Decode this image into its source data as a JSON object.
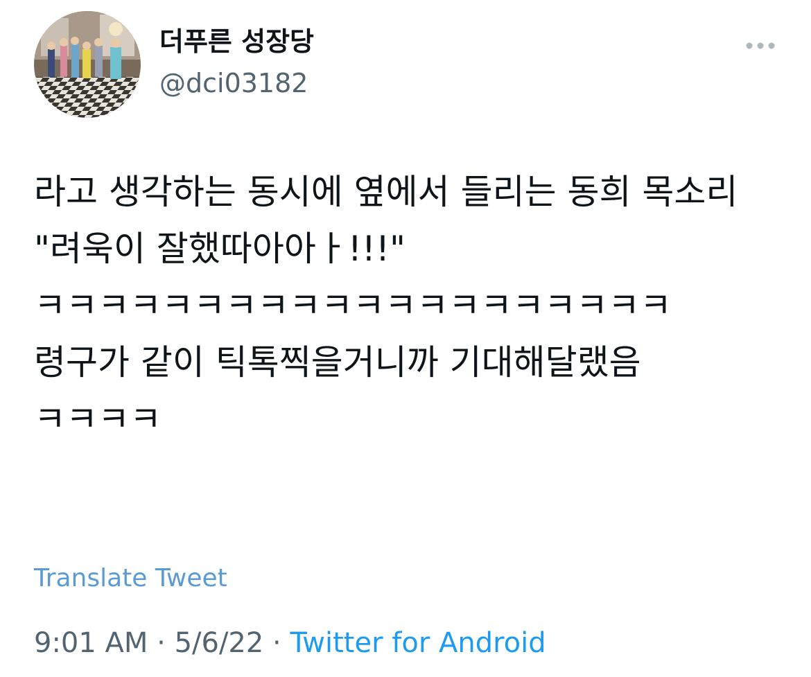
{
  "author": {
    "display_name": "더푸른 성장당",
    "handle": "@dci03182",
    "avatar_icon": "profile-photo"
  },
  "tweet": {
    "text": "라고 생각하는 동시에 옆에서 들리는 동희 목소리 \"려욱이 잘했따아아ㅏ!!!\"\nㅋㅋㅋㅋㅋㅋㅋㅋㅋㅋㅋㅋㅋㅋㅋㅋㅋㅋㅋㅋ\n령구가 같이 틱톡찍을거니까 기대해달랬음\nㅋㅋㅋㅋ"
  },
  "actions": {
    "more_icon": "more-horizontal-icon",
    "translate_label": "Translate Tweet"
  },
  "meta": {
    "time": "9:01 AM",
    "separator": "·",
    "date": "5/6/22",
    "source": "Twitter for Android"
  },
  "colors": {
    "text": "#0f1419",
    "secondary": "#536471",
    "link": "#1d9bf0",
    "translate": "#5b9bd5",
    "more_dots": "#aab8c2"
  }
}
